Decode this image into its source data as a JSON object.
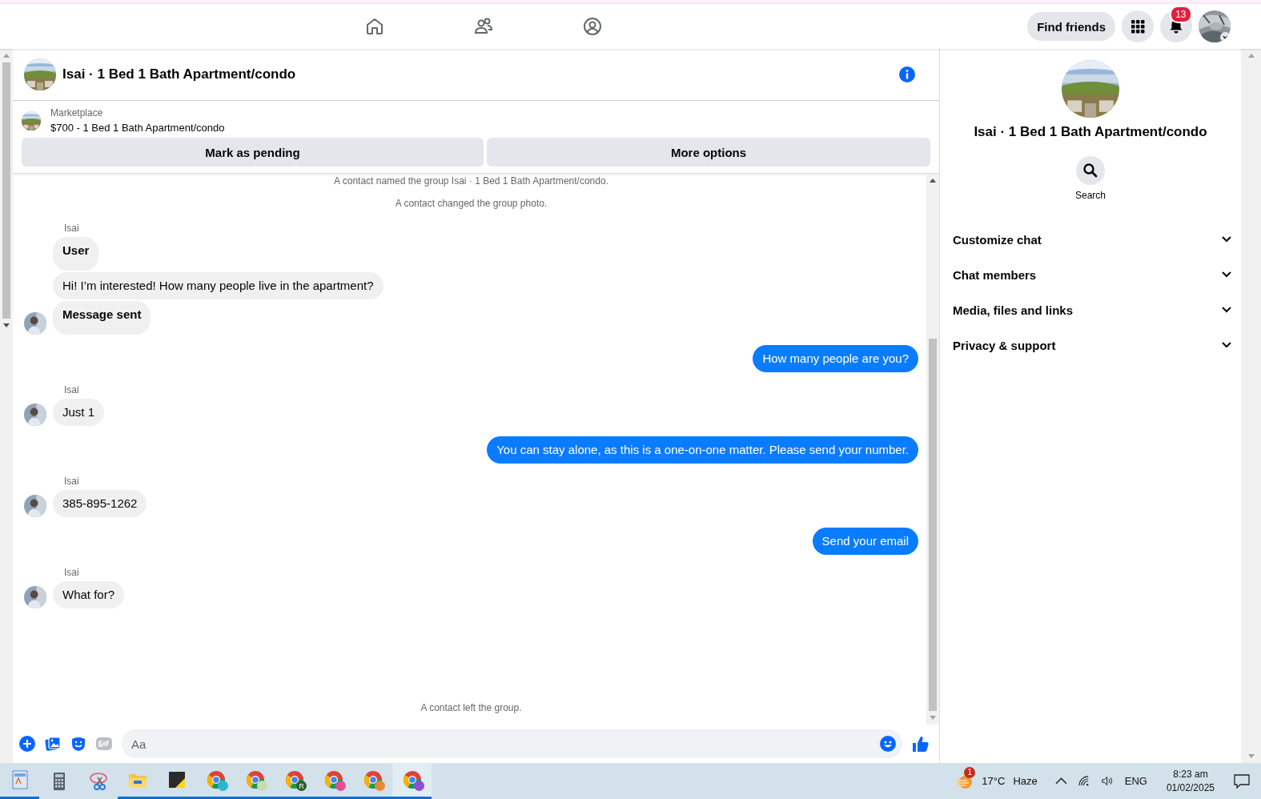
{
  "top_bar": {
    "find_friends": "Find friends",
    "notification_count": "13"
  },
  "chat": {
    "title": "Isai · 1 Bed 1 Bath Apartment/condo",
    "listing": {
      "source": "Marketplace",
      "title": "$700 - 1 Bed 1 Bath Apartment/condo"
    },
    "actions": [
      "Mark as pending",
      "More options"
    ],
    "messages": [
      {
        "kind": "system",
        "text": "A contact named the group Isai · 1 Bed 1 Bath Apartment/condo."
      },
      {
        "kind": "system",
        "text": "A contact changed the group photo."
      },
      {
        "kind": "incoming",
        "sender": "Isai",
        "bubbles": [
          {
            "text": "User",
            "bold": true
          },
          {
            "text": "Hi! I’m interested! How many people live in the apartment?",
            "bold": false
          },
          {
            "text": "Message sent",
            "bold": true
          }
        ]
      },
      {
        "kind": "outgoing",
        "bubbles": [
          {
            "text": "How many people are you?",
            "bold": false
          }
        ]
      },
      {
        "kind": "incoming",
        "sender": "Isai",
        "bubbles": [
          {
            "text": "Just 1",
            "bold": false
          }
        ]
      },
      {
        "kind": "outgoing",
        "bubbles": [
          {
            "text": "You can stay alone, as this is a one-on-one matter. Please send your number.",
            "bold": false
          }
        ]
      },
      {
        "kind": "incoming",
        "sender": "Isai",
        "bubbles": [
          {
            "text": "385-895-1262",
            "bold": false
          }
        ]
      },
      {
        "kind": "outgoing",
        "bubbles": [
          {
            "text": "Send your email",
            "bold": false
          }
        ]
      },
      {
        "kind": "incoming",
        "sender": "Isai",
        "bubbles": [
          {
            "text": "What for?",
            "bold": false
          }
        ]
      },
      {
        "kind": "system",
        "text": "A contact left the group."
      }
    ],
    "composer": {
      "placeholder": "Aa"
    }
  },
  "details": {
    "title": "Isai · 1 Bed 1 Bath Apartment/condo",
    "search": "Search",
    "sections": [
      {
        "label": "Customize chat",
        "expanded": false
      },
      {
        "label": "Chat members",
        "expanded": false
      },
      {
        "label": "Media, files and links",
        "expanded": false
      },
      {
        "label": "Privacy & support",
        "expanded": false
      }
    ]
  },
  "taskbar": {
    "apps": [
      {
        "kind": "document",
        "open": true,
        "active": false
      },
      {
        "kind": "calculator",
        "open": false,
        "active": false
      },
      {
        "kind": "scissors",
        "open": false,
        "active": false
      },
      {
        "kind": "folder",
        "open": true,
        "active": false
      },
      {
        "kind": "note",
        "open": true,
        "active": false
      },
      {
        "kind": "browser",
        "open": true,
        "active": false,
        "color": "#2bb5d8"
      },
      {
        "kind": "browser",
        "open": true,
        "active": false,
        "color": "#c8dcb0"
      },
      {
        "kind": "browser",
        "open": true,
        "active": false,
        "color": "#2e5e2a",
        "badge": "R"
      },
      {
        "kind": "browser",
        "open": true,
        "active": false,
        "color": "#e04f9a"
      },
      {
        "kind": "browser",
        "open": true,
        "active": false,
        "color": "#e8893a"
      },
      {
        "kind": "browser",
        "open": true,
        "active": true,
        "color": "#8e4fd0"
      }
    ],
    "weather": {
      "badge": "1",
      "temperature": "17°C",
      "condition": "Haze"
    },
    "language": "ENG",
    "time": "8:23 am",
    "date": "01/02/2025"
  }
}
